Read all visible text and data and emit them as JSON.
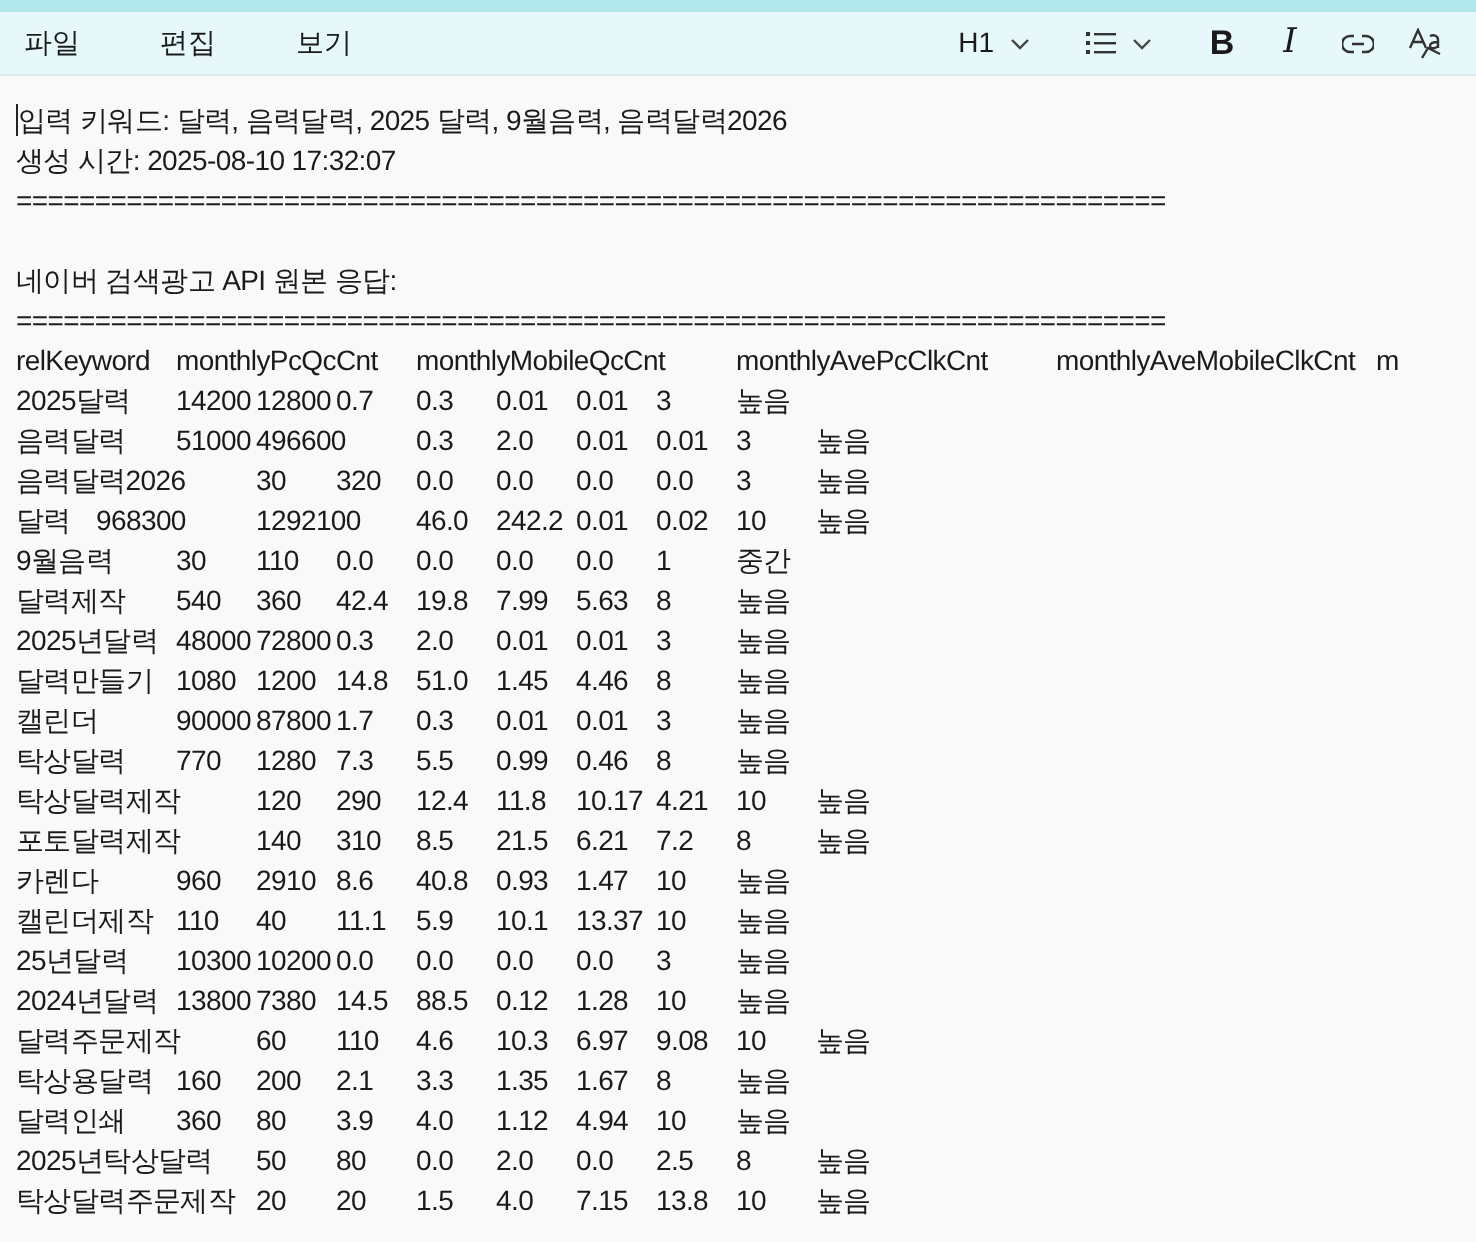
{
  "menu": [
    "파일",
    "편집",
    "보기"
  ],
  "toolbar": {
    "heading": "H1",
    "format_buttons": [
      "B",
      "I"
    ]
  },
  "sections": [
    {
      "lines": [
        "입력 키워드: 달력, 음력달력, 2025 달력, 9월음력, 음력달력2026",
        "생성 시간: 2025-08-10 17:32:07",
        "========================================================================="
      ]
    },
    {
      "lines": [
        "네이버 검색광고 API 원본 응답:",
        "=========================================================================",
        "relKeyword\tmonthlyPcQcCnt\tmonthlyMobileQcCnt\tmonthlyAvePcClkCnt\tmonthlyAveMobileClkCnt\tm",
        "2025달력\t14200\t12800\t0.7\t0.3\t0.01\t0.01\t3\t높음",
        "음력달력\t51000\t496600\t0.3\t2.0\t0.01\t0.01\t3\t높음",
        "음력달력2026\t30\t320\t0.0\t0.0\t0.0\t0.0\t3\t높음",
        "달력\t968300\t1292100\t46.0\t242.2\t0.01\t0.02\t10\t높음",
        "9월음력\t30\t110\t0.0\t0.0\t0.0\t0.0\t1\t중간",
        "달력제작\t540\t360\t42.4\t19.8\t7.99\t5.63\t8\t높음",
        "2025년달력\t48000\t72800\t0.3\t2.0\t0.01\t0.01\t3\t높음",
        "달력만들기\t1080\t1200\t14.8\t51.0\t1.45\t4.46\t8\t높음",
        "캘린더\t90000\t87800\t1.7\t0.3\t0.01\t0.01\t3\t높음",
        "탁상달력\t770\t1280\t7.3\t5.5\t0.99\t0.46\t8\t높음",
        "탁상달력제작\t120\t290\t12.4\t11.8\t10.17\t4.21\t10\t높음",
        "포토달력제작\t140\t310\t8.5\t21.5\t6.21\t7.2\t8\t높음",
        "카렌다\t960\t2910\t8.6\t40.8\t0.93\t1.47\t10\t높음",
        "캘린더제작\t110\t40\t11.1\t5.9\t10.1\t13.37\t10\t높음",
        "25년달력\t10300\t10200\t0.0\t0.0\t0.0\t0.0\t3\t높음",
        "2024년달력\t13800\t7380\t14.5\t88.5\t0.12\t1.28\t10\t높음",
        "달력주문제작\t60\t110\t4.6\t10.3\t6.97\t9.08\t10\t높음",
        "탁상용달력\t160\t200\t2.1\t3.3\t1.35\t1.67\t8\t높음",
        "달력인쇄\t360\t80\t3.9\t4.0\t1.12\t4.94\t10\t높음",
        "2025년탁상달력\t50\t80\t0.0\t2.0\t0.0\t2.5\t8\t높음",
        "탁상달력주문제작\t20\t20\t1.5\t4.0\t7.15\t13.8\t10\t높음"
      ]
    }
  ]
}
